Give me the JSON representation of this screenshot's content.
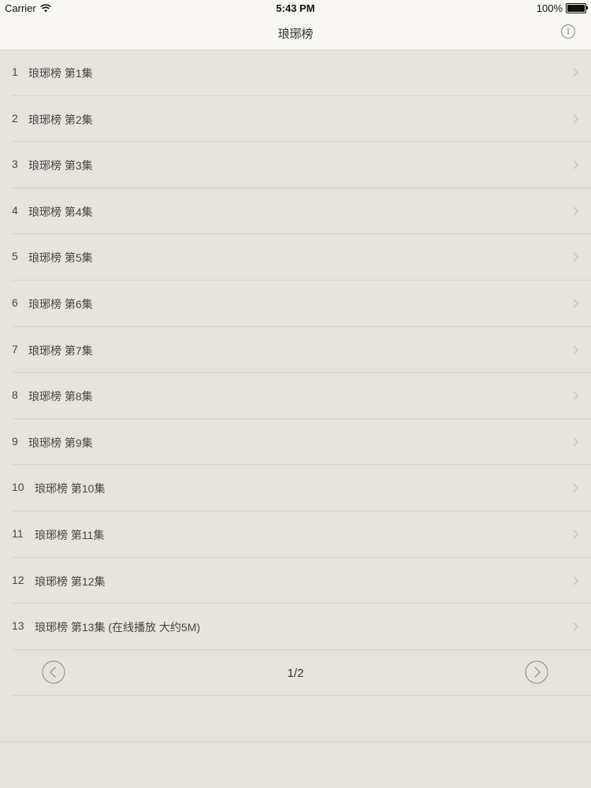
{
  "status_bar": {
    "carrier": "Carrier",
    "time": "5:43 PM",
    "battery": "100%",
    "battery_level": 1.0
  },
  "nav": {
    "title": "琅琊榜",
    "info_label": "i"
  },
  "episodes": [
    {
      "num": "1",
      "title": "琅琊榜 第1集"
    },
    {
      "num": "2",
      "title": "琅琊榜 第2集"
    },
    {
      "num": "3",
      "title": "琅琊榜 第3集"
    },
    {
      "num": "4",
      "title": "琅琊榜 第4集"
    },
    {
      "num": "5",
      "title": "琅琊榜 第5集"
    },
    {
      "num": "6",
      "title": "琅琊榜 第6集"
    },
    {
      "num": "7",
      "title": "琅琊榜 第7集"
    },
    {
      "num": "8",
      "title": "琅琊榜 第8集"
    },
    {
      "num": "9",
      "title": "琅琊榜 第9集"
    },
    {
      "num": "10",
      "title": "琅琊榜 第10集"
    },
    {
      "num": "11",
      "title": "琅琊榜 第11集"
    },
    {
      "num": "12",
      "title": "琅琊榜 第12集"
    },
    {
      "num": "13",
      "title": "琅琊榜 第13集 (在线播放 大约5M)"
    }
  ],
  "pager": {
    "text": "1/2"
  },
  "icons": {
    "wifi": "wifi-icon",
    "battery": "battery-icon",
    "info": "info-icon",
    "chevron": "chevron-right-icon",
    "prev": "circle-chevron-left-icon",
    "next": "circle-chevron-right-icon"
  },
  "colors": {
    "background": "#e6e4dd",
    "bar": "#f7f6f3",
    "separator": "#d5d2ca",
    "chevron": "#c7c5bf"
  }
}
